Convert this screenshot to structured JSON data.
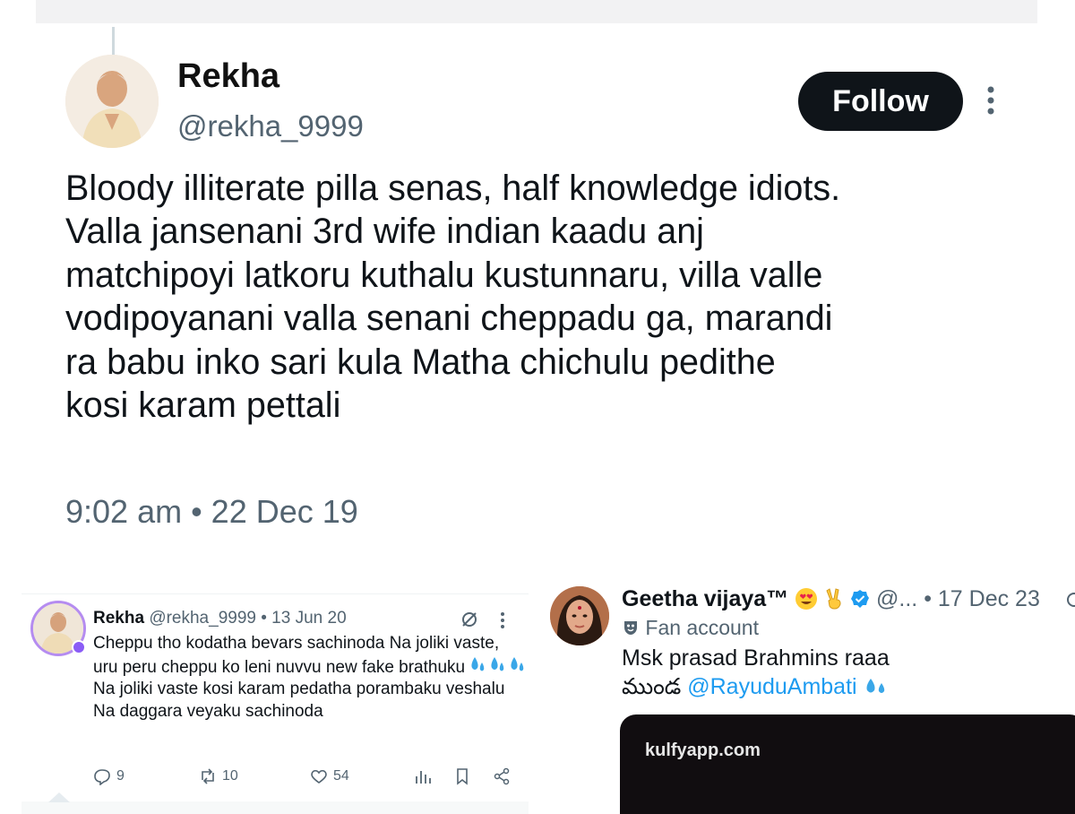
{
  "main_tweet": {
    "name": "Rekha",
    "handle": "@rekha_9999",
    "follow_label": "Follow",
    "text": "Bloody illiterate pilla senas, half knowledge idiots.\nValla jansenani 3rd wife indian kaadu anj\nmatchipoyi latkoru kuthalu kustunnaru, villa valle\nvodipoyanani valla senani cheppadu ga, marandi\nra babu inko sari kula Matha chichulu pedithe\nkosi karam pettali",
    "timestamp": "9:02 am • 22 Dec 19",
    "icons": [
      "avatar",
      "more-icon"
    ]
  },
  "left_tweet": {
    "name": "Rekha",
    "handle_date": "@rekha_9999 • 13 Jun 20",
    "text_line1": "Cheppu tho kodatha bevars sachinoda Na joliki vaste, uru peru cheppu ko leni nuvvu new fake brathuku",
    "text_line2": "Na joliki vaste kosi karam pedatha porambaku veshalu Na daggara veyaku sachinoda",
    "replies": "9",
    "reposts": "10",
    "likes": "54",
    "icons": [
      "grok-icon",
      "more-icon",
      "reply-icon",
      "repost-icon",
      "like-icon",
      "views-icon",
      "bookmark-icon",
      "share-icon",
      "sweat-droplets-emoji"
    ]
  },
  "right_tweet": {
    "name": "Geetha vijaya™",
    "meta": "@... • 17 Dec 23",
    "label": "Fan account",
    "text_line1": "Msk prasad Brahmins raaa",
    "text_prefix": "ముండ ",
    "mention": "@RayuduAmbati",
    "media_url": "kulfyapp.com",
    "icons": [
      "heart-eyes-emoji",
      "victory-hand-emoji",
      "verified-badge-icon",
      "theater-masks-icon",
      "sweat-droplets-emoji"
    ]
  },
  "colors": {
    "text": "#0f1419",
    "secondary": "#536471",
    "accent": "#1d9bf0",
    "follow_bg": "#0f1419"
  }
}
